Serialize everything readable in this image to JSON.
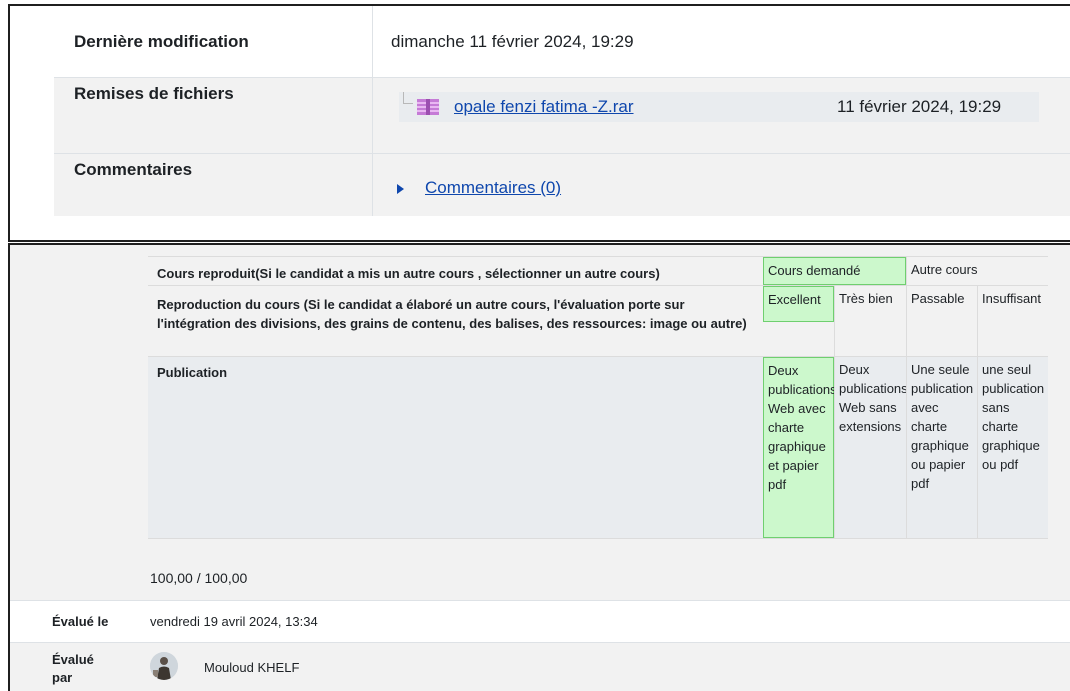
{
  "submission": {
    "last_modified": {
      "label": "Dernière modification",
      "value": "dimanche 11 février 2024, 19:29"
    },
    "file_submissions": {
      "label": "Remises de fichiers",
      "file_icon": "rar-archive-icon",
      "file_name": "opale fenzi fatima -Z.rar",
      "file_date": "11 février 2024, 19:29"
    },
    "comments": {
      "label": "Commentaires",
      "link": "Commentaires (0)",
      "toggle_icon": "expand-triangle-icon"
    }
  },
  "rubric": {
    "criteria": [
      {
        "description": "Cours reproduit(Si le candidat a mis un autre cours , sélectionner un autre cours)",
        "levels": [
          "Cours demandé",
          "Autre cours"
        ],
        "selected": 0
      },
      {
        "description": "Reproduction du cours (Si le candidat a élaboré un autre cours, l'évaluation porte sur l'intégration des divisions, des grains de contenu, des balises, des ressources: image ou autre)",
        "levels": [
          "Excellent",
          "Très bien",
          "Passable",
          "Insuffisant"
        ],
        "selected": 0
      },
      {
        "description": "Publication",
        "levels": [
          "Deux publications: Web avec charte graphique et papier pdf",
          "Deux publications: Web sans extensions",
          "Une seule publication avec charte graphique ou papier pdf",
          "une seul publication sans charte graphique ou pdf"
        ],
        "selected": 0
      }
    ]
  },
  "grade": {
    "score": "100,00 / 100,00",
    "graded_on_label": "Évalué le",
    "graded_on": "vendredi 19 avril 2024, 13:34",
    "graded_by_label": "Évalué par",
    "grader_name": "Mouloud KHELF"
  },
  "colors": {
    "link": "#0f47ad",
    "selected_level": "#ccf8cc",
    "selected_border": "#6fcf6f",
    "row_alt": "#f2f2f2"
  }
}
